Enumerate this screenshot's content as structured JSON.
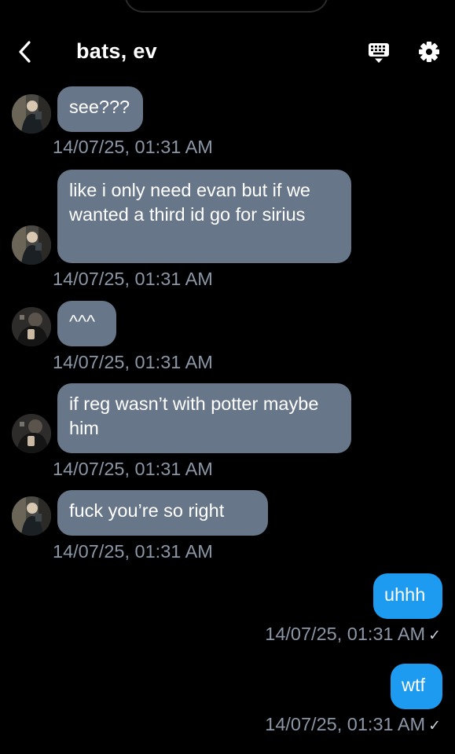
{
  "header": {
    "title": "bats, ev",
    "back_icon": "chevron-left-icon",
    "keyboard_icon": "keyboard-icon",
    "settings_icon": "gear-icon"
  },
  "messages": [
    {
      "direction": "incoming",
      "text": "see???",
      "time": "14/07/25, 01:31 AM"
    },
    {
      "direction": "incoming",
      "text": "like i only need evan but if we wanted a third id go for sirius",
      "time": "14/07/25, 01:31 AM"
    },
    {
      "direction": "incoming",
      "text": "^^^",
      "time": "14/07/25, 01:31 AM"
    },
    {
      "direction": "incoming",
      "text": "if reg wasn’t with potter maybe him",
      "time": "14/07/25, 01:31 AM"
    },
    {
      "direction": "incoming",
      "text": "fuck you’re so right",
      "time": "14/07/25, 01:31 AM"
    },
    {
      "direction": "outgoing",
      "text": "uhhh",
      "time": "14/07/25, 01:31 AM",
      "status": "✓"
    },
    {
      "direction": "outgoing",
      "text": "wtf",
      "time": "14/07/25, 01:31 AM",
      "status": "✓"
    }
  ],
  "colors": {
    "background": "#000000",
    "incoming_bubble": "#687689",
    "outgoing_bubble": "#1d9bf0",
    "timestamp": "#8b97a6"
  }
}
